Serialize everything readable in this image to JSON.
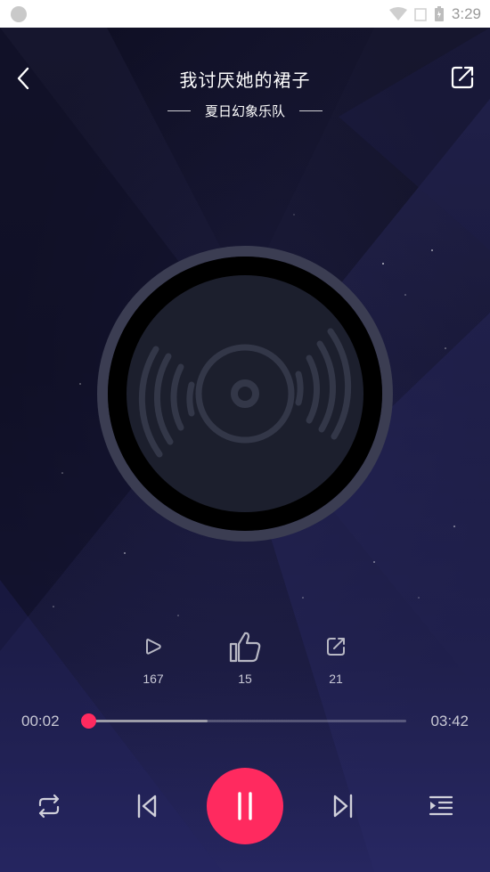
{
  "status_bar": {
    "time": "3:29"
  },
  "song": {
    "title": "我讨厌她的裙子",
    "artist": "夏日幻象乐队"
  },
  "stats": {
    "plays": "167",
    "likes": "15",
    "shares": "21"
  },
  "progress": {
    "current": "00:02",
    "total": "03:42",
    "played_fraction": 0.009,
    "buffered_fraction": 0.38
  },
  "colors": {
    "accent": "#ff2a5f",
    "background": "#14142e"
  },
  "icons": {
    "back": "chevron-left-icon",
    "share": "share-icon",
    "repeat": "repeat-icon",
    "previous": "skip-previous-icon",
    "pause": "pause-icon",
    "next": "skip-next-icon",
    "playlist": "playlist-icon"
  }
}
